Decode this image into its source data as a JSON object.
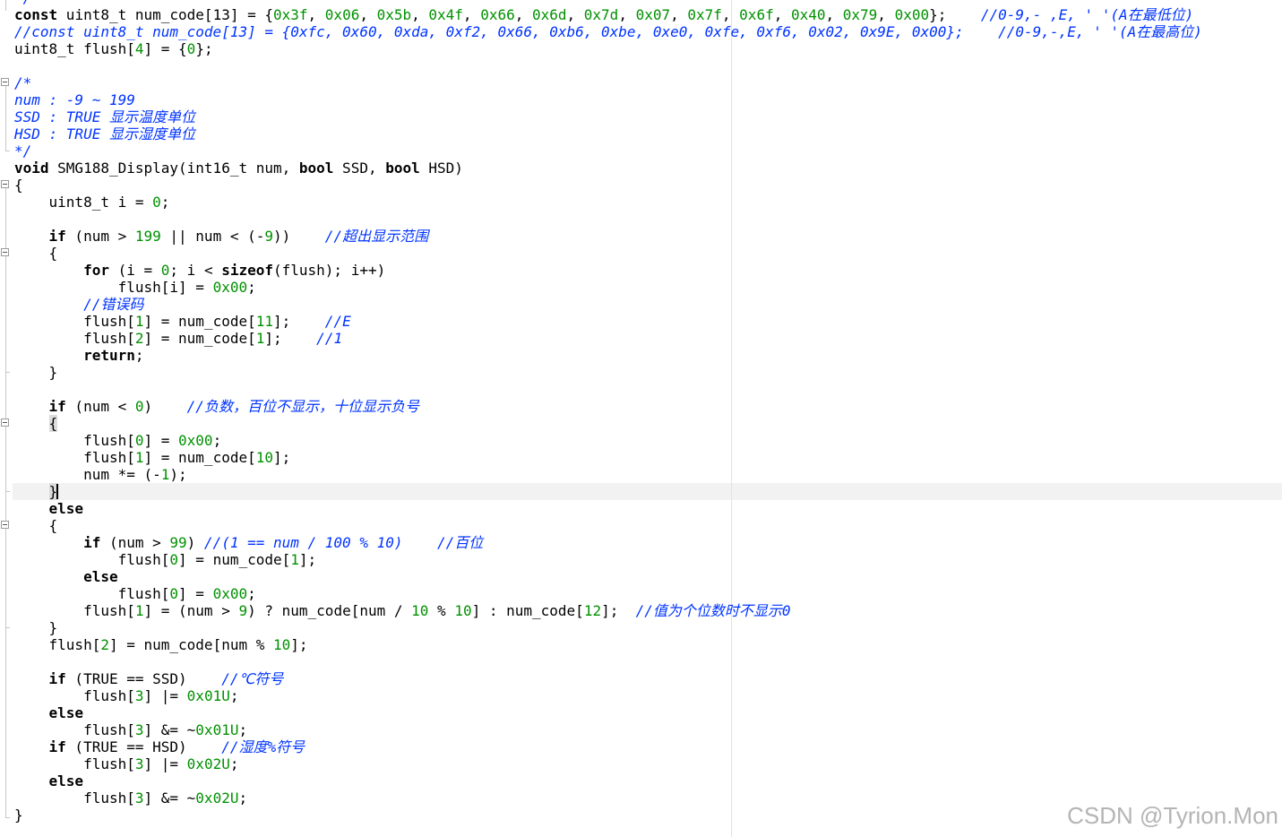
{
  "editor": {
    "language": "C",
    "watermark": "CSDN @Tyrion.Mon",
    "colors": {
      "background": "#ffffff",
      "keyword": "#000000",
      "number": "#009100",
      "comment": "#0033ff",
      "current_line": "#f2f2f2",
      "watermark": "#b4b4b4"
    },
    "lines": [
      [
        {
          "t": "*/",
          "c": "cm"
        }
      ],
      [
        {
          "t": "const",
          "c": "kw"
        },
        {
          "t": " uint8_t num_code[13] = {"
        },
        {
          "t": "0x3f",
          "c": "num"
        },
        {
          "t": ", "
        },
        {
          "t": "0x06",
          "c": "num"
        },
        {
          "t": ", "
        },
        {
          "t": "0x5b",
          "c": "num"
        },
        {
          "t": ", "
        },
        {
          "t": "0x4f",
          "c": "num"
        },
        {
          "t": ", "
        },
        {
          "t": "0x66",
          "c": "num"
        },
        {
          "t": ", "
        },
        {
          "t": "0x6d",
          "c": "num"
        },
        {
          "t": ", "
        },
        {
          "t": "0x7d",
          "c": "num"
        },
        {
          "t": ", "
        },
        {
          "t": "0x07",
          "c": "num"
        },
        {
          "t": ", "
        },
        {
          "t": "0x7f",
          "c": "num"
        },
        {
          "t": ", "
        },
        {
          "t": "0x6f",
          "c": "num"
        },
        {
          "t": ", "
        },
        {
          "t": "0x40",
          "c": "num"
        },
        {
          "t": ", "
        },
        {
          "t": "0x79",
          "c": "num"
        },
        {
          "t": ", "
        },
        {
          "t": "0x00",
          "c": "num"
        },
        {
          "t": "};    "
        },
        {
          "t": "//0-9,- ,E, ' '(A在最低位)",
          "c": "cm"
        }
      ],
      [
        {
          "t": "//const uint8_t num_code[13] = {0xfc, 0x60, 0xda, 0xf2, 0x66, 0xb6, 0xbe, 0xe0, 0xfe, 0xf6, 0x02, 0x9E, 0x00};    //0-9,-,E, ' '(A在最高位)",
          "c": "cm"
        }
      ],
      [
        {
          "t": "uint8_t flush["
        },
        {
          "t": "4",
          "c": "num"
        },
        {
          "t": "] = {"
        },
        {
          "t": "0",
          "c": "num"
        },
        {
          "t": "};"
        }
      ],
      [],
      [
        {
          "t": "/*",
          "c": "cm"
        }
      ],
      [
        {
          "t": "num : -9 ~ 199",
          "c": "cm"
        }
      ],
      [
        {
          "t": "SSD : TRUE 显示温度单位",
          "c": "cm"
        }
      ],
      [
        {
          "t": "HSD : TRUE 显示湿度单位",
          "c": "cm"
        }
      ],
      [
        {
          "t": "*/",
          "c": "cm"
        }
      ],
      [
        {
          "t": "void",
          "c": "kw"
        },
        {
          "t": " SMG188_Display(int16_t num, "
        },
        {
          "t": "bool",
          "c": "kw"
        },
        {
          "t": " SSD, "
        },
        {
          "t": "bool",
          "c": "kw"
        },
        {
          "t": " HSD)"
        }
      ],
      [
        {
          "t": "{"
        }
      ],
      [
        {
          "t": "    uint8_t i = "
        },
        {
          "t": "0",
          "c": "num"
        },
        {
          "t": ";"
        }
      ],
      [],
      [
        {
          "t": "    "
        },
        {
          "t": "if",
          "c": "kw"
        },
        {
          "t": " (num > "
        },
        {
          "t": "199",
          "c": "num"
        },
        {
          "t": " || num < (-"
        },
        {
          "t": "9",
          "c": "num"
        },
        {
          "t": "))    "
        },
        {
          "t": "//超出显示范围",
          "c": "cm"
        }
      ],
      [
        {
          "t": "    {"
        }
      ],
      [
        {
          "t": "        "
        },
        {
          "t": "for",
          "c": "kw"
        },
        {
          "t": " (i = "
        },
        {
          "t": "0",
          "c": "num"
        },
        {
          "t": "; i < "
        },
        {
          "t": "sizeof",
          "c": "kw"
        },
        {
          "t": "(flush); i++)"
        }
      ],
      [
        {
          "t": "            flush[i] = "
        },
        {
          "t": "0x00",
          "c": "num"
        },
        {
          "t": ";"
        }
      ],
      [
        {
          "t": "        "
        },
        {
          "t": "//错误码",
          "c": "cm"
        }
      ],
      [
        {
          "t": "        flush["
        },
        {
          "t": "1",
          "c": "num"
        },
        {
          "t": "] = num_code["
        },
        {
          "t": "11",
          "c": "num"
        },
        {
          "t": "];    "
        },
        {
          "t": "//E",
          "c": "cm"
        }
      ],
      [
        {
          "t": "        flush["
        },
        {
          "t": "2",
          "c": "num"
        },
        {
          "t": "] = num_code["
        },
        {
          "t": "1",
          "c": "num"
        },
        {
          "t": "];    "
        },
        {
          "t": "//1",
          "c": "cm"
        }
      ],
      [
        {
          "t": "        "
        },
        {
          "t": "return",
          "c": "kw"
        },
        {
          "t": ";"
        }
      ],
      [
        {
          "t": "    }"
        }
      ],
      [],
      [
        {
          "t": "    "
        },
        {
          "t": "if",
          "c": "kw"
        },
        {
          "t": " (num < "
        },
        {
          "t": "0",
          "c": "num"
        },
        {
          "t": ")    "
        },
        {
          "t": "//负数，百位不显示，十位显示负号",
          "c": "cm"
        }
      ],
      [
        {
          "t": "    "
        },
        {
          "t": "{",
          "c": "hlb"
        }
      ],
      [
        {
          "t": "        flush["
        },
        {
          "t": "0",
          "c": "num"
        },
        {
          "t": "] = "
        },
        {
          "t": "0x00",
          "c": "num"
        },
        {
          "t": ";"
        }
      ],
      [
        {
          "t": "        flush["
        },
        {
          "t": "1",
          "c": "num"
        },
        {
          "t": "] = num_code["
        },
        {
          "t": "10",
          "c": "num"
        },
        {
          "t": "];"
        }
      ],
      [
        {
          "t": "        num *= (-"
        },
        {
          "t": "1",
          "c": "num"
        },
        {
          "t": ");"
        }
      ],
      [
        {
          "t": "    "
        },
        {
          "t": "}",
          "c": "hlb"
        },
        {
          "t": "",
          "c": "caret"
        }
      ],
      [
        {
          "t": "    "
        },
        {
          "t": "else",
          "c": "kw"
        }
      ],
      [
        {
          "t": "    {"
        }
      ],
      [
        {
          "t": "        "
        },
        {
          "t": "if",
          "c": "kw"
        },
        {
          "t": " (num > "
        },
        {
          "t": "99",
          "c": "num"
        },
        {
          "t": ") "
        },
        {
          "t": "//(1 == num / 100 % 10)    //百位",
          "c": "cm"
        }
      ],
      [
        {
          "t": "            flush["
        },
        {
          "t": "0",
          "c": "num"
        },
        {
          "t": "] = num_code["
        },
        {
          "t": "1",
          "c": "num"
        },
        {
          "t": "];"
        }
      ],
      [
        {
          "t": "        "
        },
        {
          "t": "else",
          "c": "kw"
        }
      ],
      [
        {
          "t": "            flush["
        },
        {
          "t": "0",
          "c": "num"
        },
        {
          "t": "] = "
        },
        {
          "t": "0x00",
          "c": "num"
        },
        {
          "t": ";"
        }
      ],
      [
        {
          "t": "        flush["
        },
        {
          "t": "1",
          "c": "num"
        },
        {
          "t": "] = (num > "
        },
        {
          "t": "9",
          "c": "num"
        },
        {
          "t": ") ? num_code[num / "
        },
        {
          "t": "10",
          "c": "num"
        },
        {
          "t": " % "
        },
        {
          "t": "10",
          "c": "num"
        },
        {
          "t": "] : num_code["
        },
        {
          "t": "12",
          "c": "num"
        },
        {
          "t": "];  "
        },
        {
          "t": "//值为个位数时不显示0",
          "c": "cm"
        }
      ],
      [
        {
          "t": "    }"
        }
      ],
      [
        {
          "t": "    flush["
        },
        {
          "t": "2",
          "c": "num"
        },
        {
          "t": "] = num_code[num % "
        },
        {
          "t": "10",
          "c": "num"
        },
        {
          "t": "];"
        }
      ],
      [],
      [
        {
          "t": "    "
        },
        {
          "t": "if",
          "c": "kw"
        },
        {
          "t": " (TRUE == SSD)    "
        },
        {
          "t": "//℃符号",
          "c": "cm"
        }
      ],
      [
        {
          "t": "        flush["
        },
        {
          "t": "3",
          "c": "num"
        },
        {
          "t": "] |= "
        },
        {
          "t": "0x01U",
          "c": "num"
        },
        {
          "t": ";"
        }
      ],
      [
        {
          "t": "    "
        },
        {
          "t": "else",
          "c": "kw"
        }
      ],
      [
        {
          "t": "        flush["
        },
        {
          "t": "3",
          "c": "num"
        },
        {
          "t": "] &= ~"
        },
        {
          "t": "0x01U",
          "c": "num"
        },
        {
          "t": ";"
        }
      ],
      [
        {
          "t": "    "
        },
        {
          "t": "if",
          "c": "kw"
        },
        {
          "t": " (TRUE == HSD)    "
        },
        {
          "t": "//湿度%符号",
          "c": "cm"
        }
      ],
      [
        {
          "t": "        flush["
        },
        {
          "t": "3",
          "c": "num"
        },
        {
          "t": "] |= "
        },
        {
          "t": "0x02U",
          "c": "num"
        },
        {
          "t": ";"
        }
      ],
      [
        {
          "t": "    "
        },
        {
          "t": "else",
          "c": "kw"
        }
      ],
      [
        {
          "t": "        flush["
        },
        {
          "t": "3",
          "c": "num"
        },
        {
          "t": "] &= ~"
        },
        {
          "t": "0x02U",
          "c": "num"
        },
        {
          "t": ";"
        }
      ],
      [
        {
          "t": "}"
        }
      ]
    ]
  }
}
